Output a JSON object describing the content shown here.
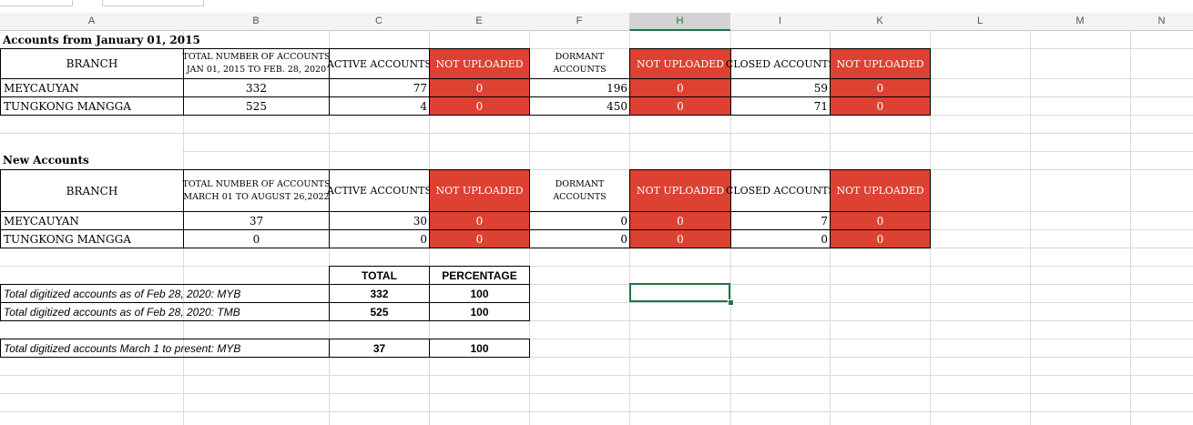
{
  "columns": [
    "A",
    "B",
    "C",
    "E",
    "F",
    "H",
    "I",
    "K",
    "L",
    "M",
    "N"
  ],
  "selected_column": "H",
  "section1": {
    "title": "Accounts from January 01, 2015",
    "headers": {
      "branch": "BRANCH",
      "total_line1": "TOTAL NUMBER OF ACCOUNTS",
      "total_line2": "JAN 01, 2015 TO FEB. 28, 2020",
      "active": "ACTIVE ACCOUNTS",
      "not_uploaded": "NOT UPLOADED",
      "dormant_line1": "DORMANT",
      "dormant_line2": "ACCOUNTS",
      "closed": "CLOSED ACCOUNTS"
    },
    "rows": [
      {
        "branch": "MEYCAUYAN",
        "total": "332",
        "active": "77",
        "nu1": "0",
        "dormant": "196",
        "nu2": "0",
        "closed": "59",
        "nu3": "0"
      },
      {
        "branch": "TUNGKONG MANGGA",
        "total": "525",
        "active": "4",
        "nu1": "0",
        "dormant": "450",
        "nu2": "0",
        "closed": "71",
        "nu3": "0"
      }
    ]
  },
  "section2": {
    "title": "New Accounts",
    "headers": {
      "branch": "BRANCH",
      "total_line1": "TOTAL NUMBER OF ACCOUNTS",
      "total_line2": "MARCH 01 TO AUGUST 26,2022",
      "active": "ACTIVE ACCOUNTS",
      "not_uploaded": "NOT UPLOADED",
      "dormant_line1": "DORMANT",
      "dormant_line2": "ACCOUNTS",
      "closed": "CLOSED ACCOUNTS"
    },
    "rows": [
      {
        "branch": "MEYCAUYAN",
        "total": "37",
        "active": "30",
        "nu1": "0",
        "dormant": "0",
        "nu2": "0",
        "closed": "7",
        "nu3": "0"
      },
      {
        "branch": "TUNGKONG MANGGA",
        "total": "0",
        "active": "0",
        "nu1": "0",
        "dormant": "0",
        "nu2": "0",
        "closed": "0",
        "nu3": "0"
      }
    ]
  },
  "summary": {
    "total_header": "TOTAL",
    "percentage_header": "PERCENTAGE",
    "rows": [
      {
        "label": "Total digitized accounts as of Feb 28, 2020: MYB",
        "total": "332",
        "percentage": "100"
      },
      {
        "label": "Total digitized accounts as of Feb 28, 2020: TMB",
        "total": "525",
        "percentage": "100"
      },
      {
        "label": "Total digitized accounts March 1 to present: MYB",
        "total": "37",
        "percentage": "100"
      }
    ]
  },
  "colors": {
    "not_uploaded_fill": "#dc4132",
    "selection": "#217346"
  }
}
